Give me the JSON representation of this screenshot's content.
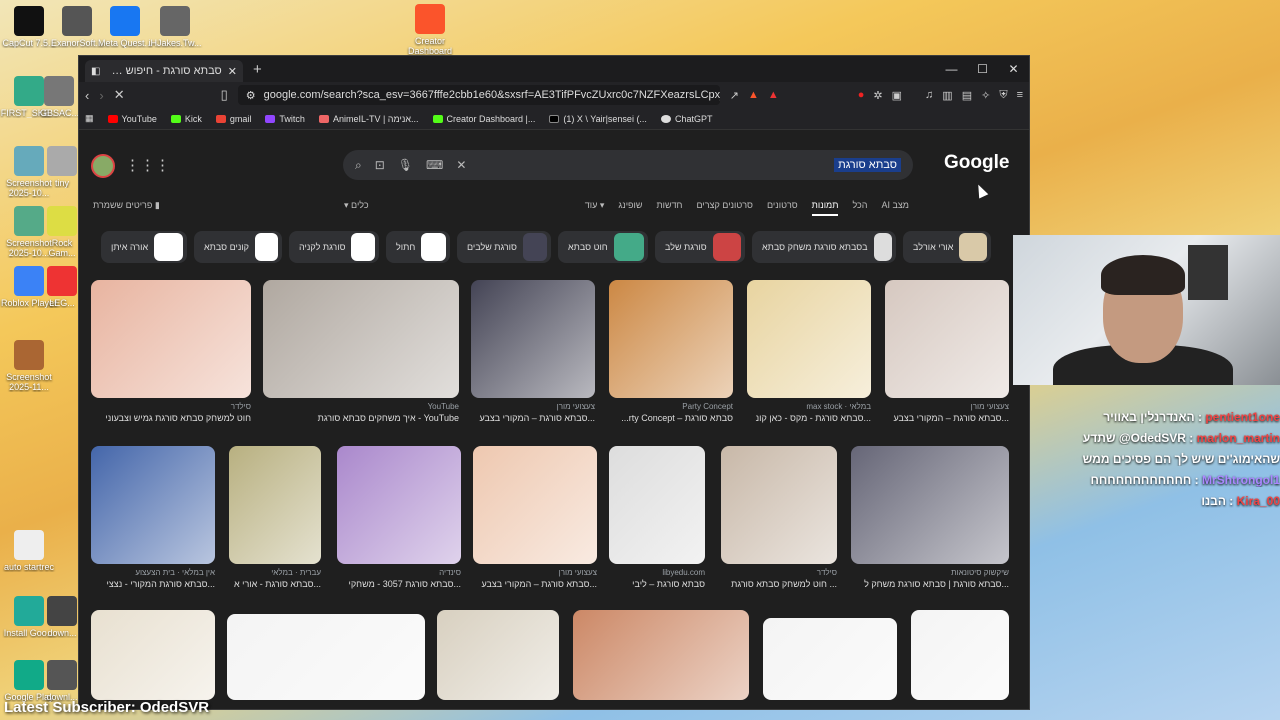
{
  "desktop": {
    "icons": [
      {
        "label": "CapCut 7.5...",
        "color": "#111"
      },
      {
        "label": "ExanorSoft...",
        "color": "#555"
      },
      {
        "label": "Meta Quest...",
        "color": "#1877f2"
      },
      {
        "label": "iHJakes.Tw...",
        "color": "#666"
      },
      {
        "label": "Creator Dashboard",
        "color": "#fb542b"
      },
      {
        "label": "FIRST_SKE...",
        "color": "#3a8"
      },
      {
        "label": "GBSAC...",
        "color": "#777"
      },
      {
        "label": "Screenshot 2025-10...",
        "color": "#6ab"
      },
      {
        "label": "tiny",
        "color": "#aaa"
      },
      {
        "label": "Screenshot 2025-10...",
        "color": "#5a8"
      },
      {
        "label": "Rock Gam...",
        "color": "#dd4"
      },
      {
        "label": "Roblox Player",
        "color": "#3b82f6"
      },
      {
        "label": "LEG...",
        "color": "#e33"
      },
      {
        "label": "Screenshot 2025-11...",
        "color": "#a63"
      },
      {
        "label": "auto startrec",
        "color": "#eee"
      },
      {
        "label": "Install Goo...",
        "color": "#2a9"
      },
      {
        "label": "down...",
        "color": "#444"
      },
      {
        "label": "Google Play",
        "color": "#1a8"
      },
      {
        "label": "downl...",
        "color": "#555"
      }
    ]
  },
  "browser": {
    "tab_title": "סבתא סורגת - חיפוש ב-Google",
    "new_tab": "+",
    "window_controls": {
      "minimize": "—",
      "maximize": "☐",
      "close": "✕"
    },
    "url": "google.com/search?sca_esv=3667fffe2cbb1e60&sxsrf=AE3TifPFvcZUxrc0c7NZFXeazrsLCpxjww:176452...",
    "bookmarks": [
      {
        "label": "YouTube",
        "color": "#f00"
      },
      {
        "label": "Kick",
        "color": "#53fc18"
      },
      {
        "label": "gmail",
        "color": "#ea4335"
      },
      {
        "label": "Twitch",
        "color": "#9146ff"
      },
      {
        "label": "AnimeIL-TV | אנימה...",
        "color": "#e66"
      },
      {
        "label": "Creator Dashboard |...",
        "color": "#53fc18"
      },
      {
        "label": "(1) X \\ Yair|sensei (...",
        "color": "#000"
      },
      {
        "label": "ChatGPT",
        "color": "#ddd"
      }
    ]
  },
  "google": {
    "logo": "Google",
    "query": "סבתא סורגת",
    "saved_label": "פריטים ששמרת",
    "tools_label": "כלים",
    "nav_tabs": [
      "מצב AI",
      "הכל",
      "תמונות",
      "סרטונים",
      "סרטונים קצרים",
      "חדשות",
      "שופינג",
      "עוד"
    ],
    "chips": [
      {
        "label": "אורה איתן",
        "color": "#fff"
      },
      {
        "label": "קונים סבתא",
        "color": "#fff"
      },
      {
        "label": "סורגת לקניה",
        "color": "#fff"
      },
      {
        "label": "חתול",
        "color": "#fff"
      },
      {
        "label": "סורגת שלבים",
        "color": "#445"
      },
      {
        "label": "חוט סבתא",
        "color": "#4a8"
      },
      {
        "label": "סורגת שלב",
        "color": "#c44"
      },
      {
        "label": "בסבתא סורגת משחק סבתא",
        "color": "#ddd"
      },
      {
        "label": "אורי אורלב",
        "color": "#d9c9a8"
      }
    ],
    "results": [
      {
        "source": "סילדר",
        "title": "חוט למשחק סבתא סורגת גמיש וצבעוני",
        "color": "#e8b4a0"
      },
      {
        "source": "YouTube",
        "title": "איך משחקים סבתא סורגת - YouTube",
        "color": "#b0a8a0"
      },
      {
        "source": "צעצועי מורן",
        "title": "סבתא סורגת – המקורי בצבע...",
        "color": "#445"
      },
      {
        "source": "Party Concept",
        "title": "...rty Concept – סבתא סורגת",
        "color": "#c84"
      },
      {
        "source": "max stock · במלאי",
        "title": "סבתא סורגת - מקס - כאן קונ...",
        "color": "#e8d4a0"
      },
      {
        "source": "צעצועי מורן",
        "title": "סבתא סורגת – המקורי בצבע...",
        "color": "#d6c8c0"
      },
      {
        "source": "אין במלאי · בית הצעצוע",
        "title": "סבתא סורגת המקורי - נצצי...",
        "color": "#4466aa"
      },
      {
        "source": "עברית · במלאי",
        "title": "סבתא סורגת - אורי א...",
        "color": "#b8b080"
      },
      {
        "source": "סינדיה",
        "title": "סבתא סורגת 3057 - משחקי...",
        "color": "#aa88cc"
      },
      {
        "source": "צעצועי מורן",
        "title": "סבתא סורגת – המקורי בצבע...",
        "color": "#eec8b0"
      },
      {
        "source": "libyedu.com",
        "title": "סבתא סורגת – ליבי",
        "color": "#ddd"
      },
      {
        "source": "סילדר",
        "title": "חוט למשחק סבתא סורגת ...",
        "color": "#c8b8a8"
      },
      {
        "source": "שיקשוק סיטונאות",
        "title": "סבתא סורגת | סבתא סורגת משחק ל...",
        "color": "#667"
      },
      {
        "source": "",
        "title": "",
        "color": "#e8e0d0"
      },
      {
        "source": "",
        "title": "",
        "color": "#f4f4f4"
      },
      {
        "source": "",
        "title": "",
        "color": "#d8d0c0"
      },
      {
        "source": "",
        "title": "",
        "color": "#c86"
      },
      {
        "source": "",
        "title": "",
        "color": "#f4f4f4"
      },
      {
        "source": "",
        "title": "",
        "color": "#f4f4f4"
      }
    ]
  },
  "stream": {
    "chat": [
      {
        "user": "pentient1one",
        "message": "האנדרנלין באוויר",
        "color": "#e44"
      },
      {
        "user": "marlon_martin",
        "message": "שתדע @OdedSVR",
        "color": "#e44"
      },
      {
        "user": "",
        "message": "שהאימוג'ים שיש לך הם פסיכים ממש",
        "color": "#fff"
      },
      {
        "user": "MrShtrongol1",
        "message": "חחחחחחחחחחחח",
        "color": "#a8f"
      },
      {
        "user": "Kira_00",
        "message": "הבנו",
        "color": "#e44"
      }
    ],
    "latest_subscriber": "Latest Subscriber: OdedSVR"
  }
}
